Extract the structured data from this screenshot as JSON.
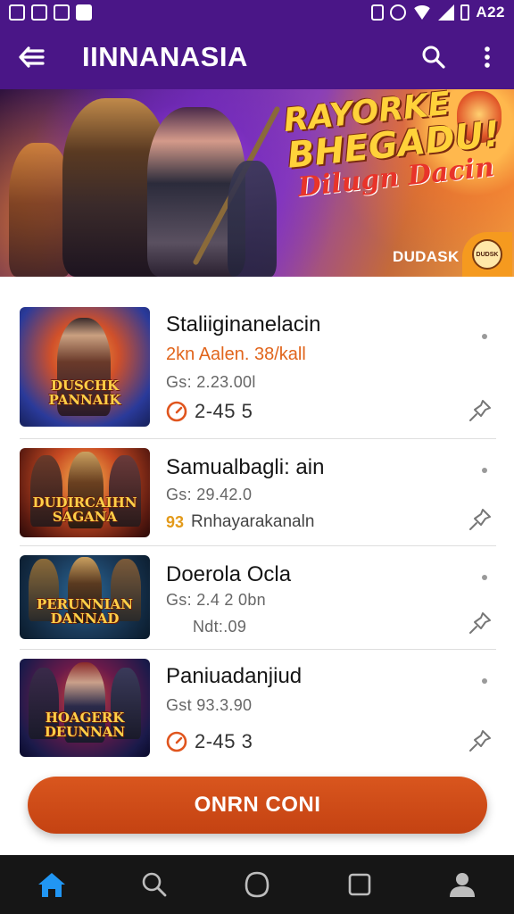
{
  "status_bar": {
    "time": "A22",
    "icons": [
      "notification-icon",
      "image-icon",
      "photo-icon",
      "vibrate-icon",
      "alarm-icon",
      "wifi-icon",
      "signal-icon",
      "battery-icon"
    ]
  },
  "app_bar": {
    "title": "IINNANASIA",
    "back_icon": "arrow-left-icon",
    "search_icon": "search-icon",
    "menu_icon": "more-vert-icon"
  },
  "banner": {
    "headline_line1": "RAYORKE",
    "headline_line2": "BHEGADU!",
    "headline_line3": "Dilugn Dacin",
    "tag": "DUDASK",
    "badge_text": "DUDSK"
  },
  "list": {
    "items": [
      {
        "thumb_title": "DUSCHK PANNAIK",
        "title": "Staliiginanelacin",
        "subtitle": "2kn Aalen. 38/kall",
        "meta": "Gs: 2.23.00l",
        "rating": "2-45 5",
        "rating_icon": "speedometer-icon",
        "pin_icon": "pin-icon"
      },
      {
        "thumb_title": "DUDIRCAIHN SAGANA",
        "title": "Samualbagli: ain",
        "meta": "Gs: 29.42.0",
        "badge": "93",
        "note": "Rnhayarakanaln",
        "pin_icon": "pin-icon"
      },
      {
        "thumb_title": "PERUNNIAN DANNAD",
        "title": "Doerola Ocla",
        "meta": "Gs: 2.4 2 0bn",
        "note": "Ndt:.09",
        "pin_icon": "pin-icon"
      },
      {
        "thumb_title": "HOAGERK DEUNNAN",
        "title": "Paniuadanjiud",
        "meta": "Gst 93.3.90",
        "rating": "2-45 3",
        "rating_icon": "speedometer-icon",
        "pin_icon": "pin-icon"
      }
    ]
  },
  "cta": {
    "label": "ONRN CONI"
  },
  "bottom_nav": {
    "items": [
      "home-icon",
      "search-icon",
      "circle-icon",
      "square-icon",
      "profile-icon"
    ],
    "active_color": "#2196f3"
  },
  "colors": {
    "primary": "#4a1687",
    "accent": "#d9561e",
    "subtitle": "#e1651c",
    "nav_bg": "#161616"
  }
}
